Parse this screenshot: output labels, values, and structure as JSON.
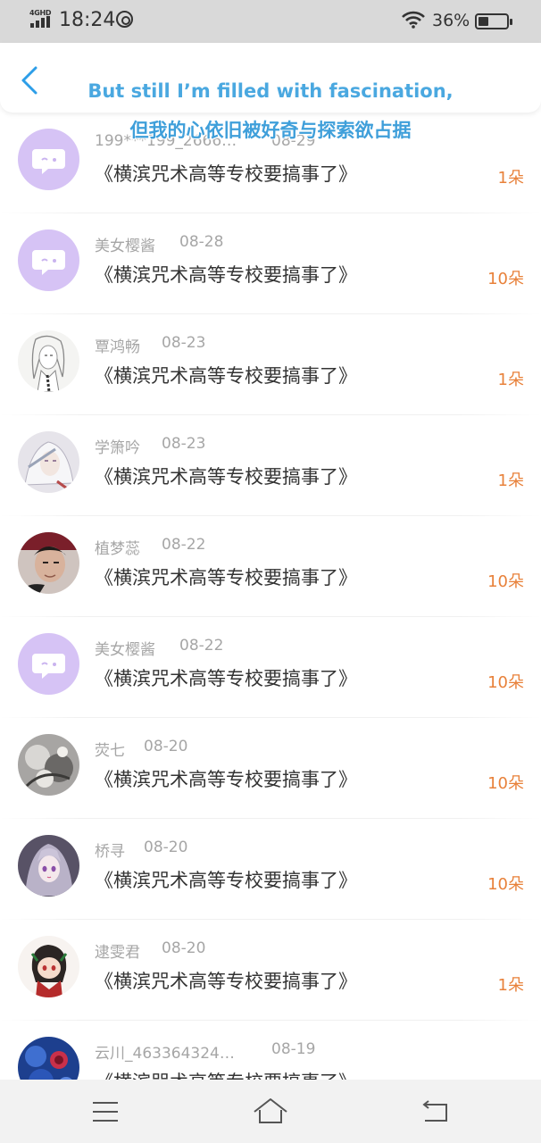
{
  "status_bar": {
    "network": "4GHD",
    "time": "18:24",
    "battery_percent": "36%",
    "battery_level": 0.36
  },
  "header": {
    "back_icon": "chevron-left-icon"
  },
  "subtitles": {
    "english": "But still I’m filled with fascination,",
    "chinese": "但我的心依旧被好奇与探索欲占据"
  },
  "list": {
    "items": [
      {
        "name": "199***199_2666…",
        "date": "08-29",
        "title": "《横滨咒术高等专校要搞事了》",
        "count": "1朵",
        "avatar": "default-chat"
      },
      {
        "name": "美女樱酱",
        "date": "08-28",
        "title": "《横滨咒术高等专校要搞事了》",
        "count": "10朵",
        "avatar": "default-chat"
      },
      {
        "name": "覃鸿畅",
        "date": "08-23",
        "title": "《横滨咒术高等专校要搞事了》",
        "count": "1朵",
        "avatar": "sketch-girl"
      },
      {
        "name": "学箫吟",
        "date": "08-23",
        "title": "《横滨咒术高等专校要搞事了》",
        "count": "1朵",
        "avatar": "anime-silver"
      },
      {
        "name": "植梦蕊",
        "date": "08-22",
        "title": "《横滨咒术高等专校要搞事了》",
        "count": "10朵",
        "avatar": "photo-man"
      },
      {
        "name": "美女樱酱",
        "date": "08-22",
        "title": "《横滨咒术高等专校要搞事了》",
        "count": "10朵",
        "avatar": "default-chat"
      },
      {
        "name": "荧七",
        "date": "08-20",
        "title": "《横滨咒术高等专校要搞事了》",
        "count": "10朵",
        "avatar": "grey-art"
      },
      {
        "name": "桥寻",
        "date": "08-20",
        "title": "《横滨咒术高等专校要搞事了》",
        "count": "10朵",
        "avatar": "anime-purple"
      },
      {
        "name": "逮雯君",
        "date": "08-20",
        "title": "《横滨咒术高等专校要搞事了》",
        "count": "1朵",
        "avatar": "chibi-red"
      },
      {
        "name": "云川_463364324…",
        "date": "08-19",
        "title": "《横滨咒术高等专校要搞事了》",
        "count": "",
        "avatar": "blue-rose"
      }
    ]
  },
  "nav_bar": {
    "menu_icon": "menu-icon",
    "home_icon": "home-icon",
    "back_icon": "back-arrow-icon"
  },
  "colors": {
    "accent_blue": "#2d9ee8",
    "count_orange": "#e8813a",
    "meta_grey": "#a6a6a6",
    "default_avatar_purple": "#d6c3f5"
  }
}
